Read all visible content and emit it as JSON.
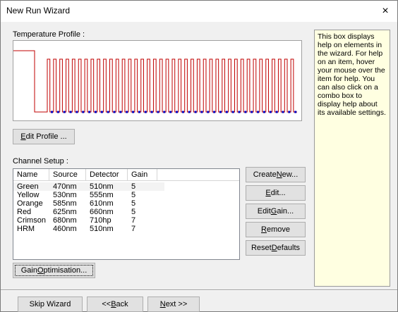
{
  "window": {
    "title": "New Run Wizard",
    "close_glyph": "×"
  },
  "temperature_profile": {
    "label": "Temperature Profile :",
    "cycles": 40,
    "line_color": "#c00000",
    "marker_color": "#0000c0"
  },
  "edit_profile_button": {
    "pre": "",
    "hotkey": "E",
    "post": "dit Profile ..."
  },
  "channel_setup": {
    "label": "Channel Setup :",
    "columns": [
      "Name",
      "Source",
      "Detector",
      "Gain"
    ],
    "rows": [
      {
        "name": "Green",
        "source": "470nm",
        "detector": "510nm",
        "gain": "5"
      },
      {
        "name": "Yellow",
        "source": "530nm",
        "detector": "555nm",
        "gain": "5"
      },
      {
        "name": "Orange",
        "source": "585nm",
        "detector": "610nm",
        "gain": "5"
      },
      {
        "name": "Red",
        "source": "625nm",
        "detector": "660nm",
        "gain": "5"
      },
      {
        "name": "Crimson",
        "source": "680nm",
        "detector": "710hp",
        "gain": "7"
      },
      {
        "name": "HRM",
        "source": "460nm",
        "detector": "510nm",
        "gain": "7"
      }
    ]
  },
  "buttons": {
    "create_new": {
      "pre": "Create ",
      "hotkey": "N",
      "post": "ew..."
    },
    "edit": {
      "pre": "",
      "hotkey": "E",
      "post": "dit..."
    },
    "edit_gain": {
      "pre": "Edit ",
      "hotkey": "G",
      "post": "ain..."
    },
    "remove": {
      "pre": "",
      "hotkey": "R",
      "post": "emove"
    },
    "reset_defaults": {
      "pre": "Reset ",
      "hotkey": "D",
      "post": "efaults"
    },
    "gain_optimisation": {
      "pre": "Gain ",
      "hotkey": "O",
      "post": "ptimisation..."
    }
  },
  "help_text": "This box displays help on elements in the wizard. For help on an item, hover your mouse over the item for help. You can also click on a combo box to display help about its available settings.",
  "footer": {
    "skip_wizard": "Skip Wizard",
    "back": {
      "pre": "<< ",
      "hotkey": "B",
      "post": "ack"
    },
    "next": {
      "pre": "",
      "hotkey": "N",
      "post": "ext >>"
    }
  }
}
